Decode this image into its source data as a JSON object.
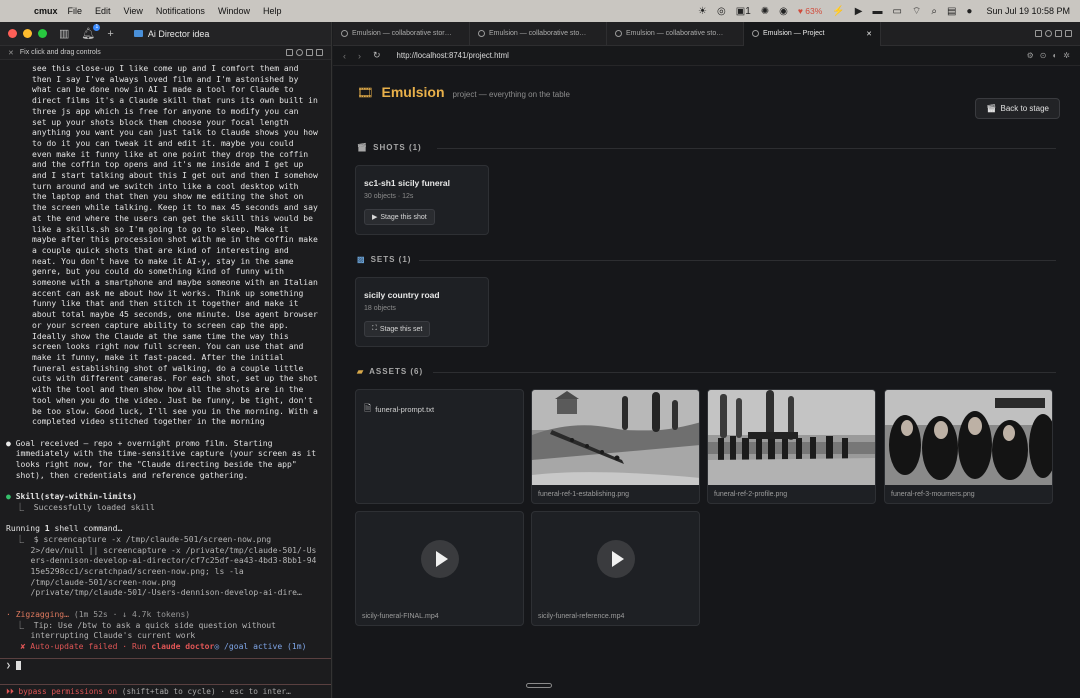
{
  "menubar": {
    "app_name": "cmux",
    "items": [
      "File",
      "Edit",
      "View",
      "Notifications",
      "Window",
      "Help"
    ],
    "battery_pct": "63%",
    "clock": "Sun Jul 19  10:58 PM",
    "tray_count": "1"
  },
  "workspace": {
    "title": "Ai Director idea",
    "notification_count": "1"
  },
  "terminal_pane": {
    "tab_label": "Fix click and drag controls",
    "user_prompt": [
      "see this close-up I like come up and I comfort them and",
      "then I say I've always loved film and I'm astonished by",
      "what can be done now in AI I made a tool for Claude to",
      "direct films it's a Claude skill that runs its own built in",
      "three js app which is free for anyone to modify you can",
      "set up your shots block them choose your focal length",
      "anything you want you can just talk to Claude shows you how",
      "to do it you can tweak it and edit it. maybe you could",
      "even make it funny like at one point they drop the coffin",
      "and the coffin top opens and it's me inside and I get up",
      "and I start talking about this I get out and then I somehow",
      "turn around and we switch into like a cool desktop with",
      "the laptop and that then you show me editing the shot on",
      "the screen while talking. Keep it to max 45 seconds and say",
      "at the end where the users can get the skill this would be",
      "like a skills.sh so I'm going to go to sleep. Make it",
      "maybe after this procession shot with me in the coffin make",
      "a couple quick shots that are kind of interesting and",
      "neat. You don't have to make it AI-y, stay in the same",
      "genre, but you could do something kind of funny with",
      "someone with a smartphone and maybe someone with an Italian",
      "accent can ask me about how it works. Think up something",
      "funny like that and then stitch it together and make it",
      "about total maybe 45 seconds, one minute. Use agent browser",
      "or your screen capture ability to screen cap the app.",
      "Ideally show the Claude at the same time the way this",
      "screen looks right now full screen. You can use that and",
      "make it funny, make it fast-paced. After the initial",
      "funeral establishing shot of walking, do a couple little",
      "cuts with different cameras. For each shot, set up the shot",
      "with the tool and then show how all the shots are in the",
      "tool when you do the video. Just be funny, be tight, don't",
      "be too slow. Good luck, I'll see you in the morning. With a",
      "completed video stitched together in the morning"
    ],
    "goal_lines": [
      "Goal received — repo + overnight promo film. Starting",
      "immediately with the time-sensitive capture (your screen as it",
      "looks right now, for the \"Claude directing beside the app\"",
      "shot), then credentials and reference gathering."
    ],
    "skill_call": "Skill(stay-within-limits)",
    "skill_result": "Successfully loaded skill",
    "running_prefix": "Running ",
    "running_count": "1",
    "running_suffix": " shell command…",
    "shell_lines": [
      "$ screencapture -x /tmp/claude-501/screen-now.png",
      "2>/dev/null || screencapture -x /private/tmp/claude-501/-Us",
      "ers-dennison-develop-ai-director/cf7c25df-ea43-4bd3-8bb1-94",
      "15e5298cc1/scratchpad/screen-now.png; ls -la",
      "/tmp/claude-501/screen-now.png",
      "/private/tmp/claude-501/-Users-dennison-develop-ai-dire…"
    ],
    "status_word": "Zigzagging…",
    "status_meta": "(1m 52s · ↓ 4.7k tokens)",
    "tip_lines": [
      "Tip: Use /btw to ask a quick side question without",
      "interrupting Claude's current work"
    ],
    "update_failed": "✘ Auto-update failed · Run",
    "update_cmd": "claude doctor",
    "goal_active": "◎ /goal active (1m)",
    "input_prompt": "❯",
    "footer_bypass": "⏵⏵ bypass permissions on",
    "footer_rest": " (shift+tab to cycle) · esc to inter…"
  },
  "browser": {
    "tabs": [
      {
        "label": "Emulsion — collaborative stor…",
        "active": false
      },
      {
        "label": "Emulsion — collaborative sto…",
        "active": false
      },
      {
        "label": "Emulsion — collaborative sto…",
        "active": false
      },
      {
        "label": "Emulsion — Project",
        "active": true
      }
    ],
    "url": "http://localhost:8741/project.html"
  },
  "page": {
    "title": "Emulsion",
    "subtitle": "project — everything on the table",
    "back_button": "Back to stage",
    "sections": {
      "shots": {
        "label": "SHOTS (1)"
      },
      "sets": {
        "label": "SETS (1)"
      },
      "assets": {
        "label": "ASSETS (6)"
      }
    },
    "shots": [
      {
        "title": "sc1-sh1 sicily funeral",
        "meta": "30 objects · 12s",
        "button": "Stage this shot"
      }
    ],
    "sets": [
      {
        "title": "sicily country road",
        "meta": "18 objects",
        "button": "Stage this set"
      }
    ],
    "assets": [
      {
        "name": "funeral-prompt.txt",
        "kind": "text"
      },
      {
        "name": "funeral-ref-1-establishing.png",
        "kind": "image"
      },
      {
        "name": "funeral-ref-2-profile.png",
        "kind": "image"
      },
      {
        "name": "funeral-ref-3-mourners.png",
        "kind": "image"
      },
      {
        "name": "sicily-funeral-FINAL.mp4",
        "kind": "video"
      },
      {
        "name": "sicily-funeral-reference.mp4",
        "kind": "video"
      }
    ]
  },
  "colors": {
    "accent": "#e8b04a",
    "success": "#35c06b",
    "error": "#e05656",
    "status": "#e07a5f"
  }
}
